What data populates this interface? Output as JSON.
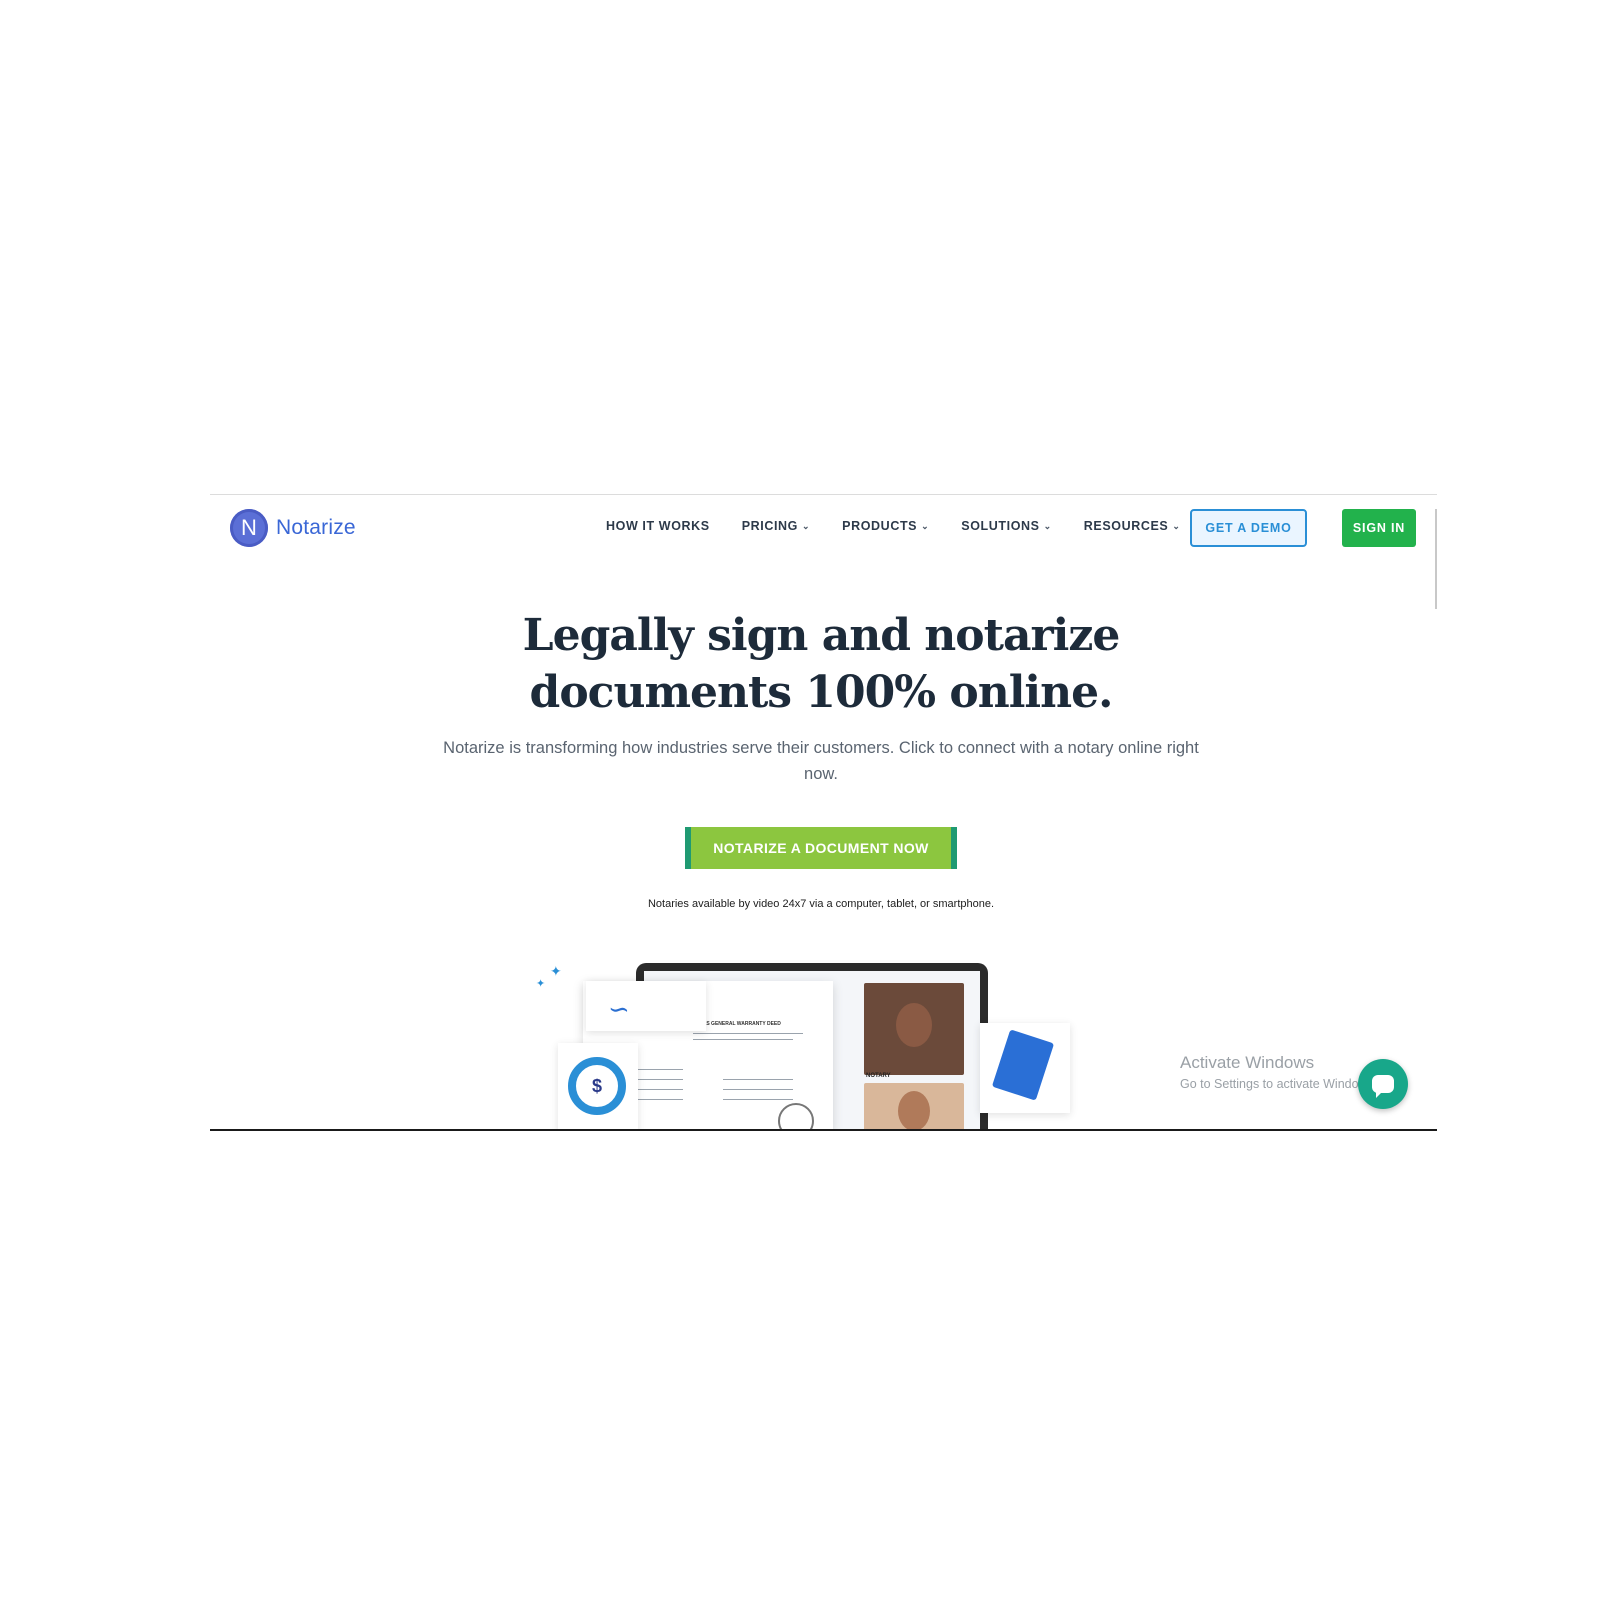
{
  "header": {
    "logo_mark": "N",
    "logo_text": "Notarize",
    "nav": [
      {
        "label": "HOW IT WORKS",
        "has_dropdown": false
      },
      {
        "label": "PRICING",
        "has_dropdown": true
      },
      {
        "label": "PRODUCTS",
        "has_dropdown": true
      },
      {
        "label": "SOLUTIONS",
        "has_dropdown": true
      },
      {
        "label": "RESOURCES",
        "has_dropdown": true
      }
    ],
    "demo_label": "GET A DEMO",
    "signin_label": "SIGN IN"
  },
  "hero": {
    "title_line1": "Legally sign and notarize",
    "title_line2": "documents 100% online.",
    "subtitle": "Notarize is transforming how industries serve their customers. Click to connect with a notary online right now.",
    "cta_label": "NOTARIZE A DOCUMENT NOW",
    "note": "Notaries available by video 24x7 via a computer, tablet, or smartphone."
  },
  "illustration": {
    "money_symbol": "$",
    "notary_label": "NOTARY",
    "doc_heading": "TEXAS GENERAL WARRANTY DEED"
  },
  "watermark": {
    "title": "Activate Windows",
    "subtitle": "Go to Settings to activate Windows."
  },
  "colors": {
    "brand_blue": "#2a8fd6",
    "cta_green": "#8cc63f",
    "signin_green": "#22b24c",
    "heading": "#1d2b3a"
  }
}
